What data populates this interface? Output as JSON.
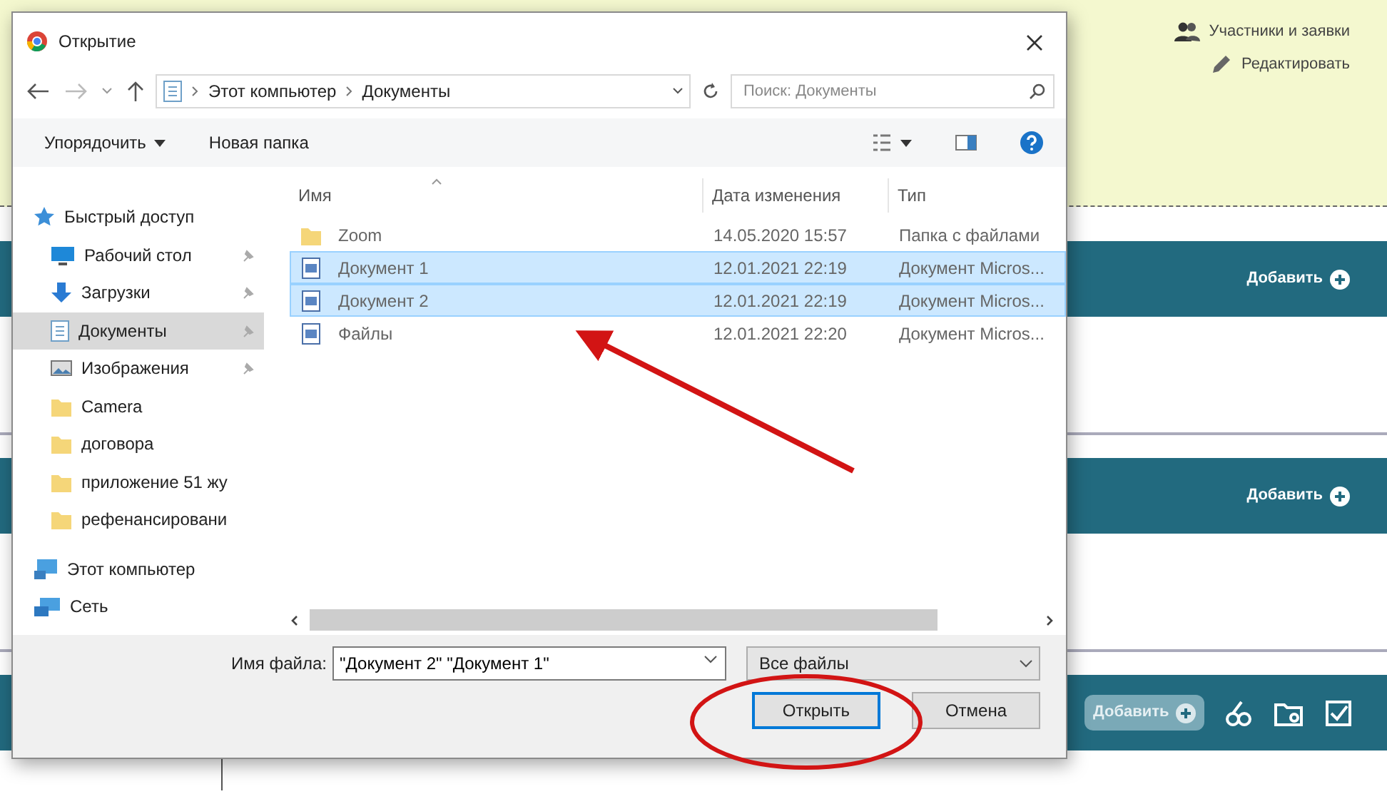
{
  "page": {
    "links": [
      {
        "label": "Участники и заявки",
        "kind": "people"
      },
      {
        "label": "Редактировать",
        "kind": "edit"
      }
    ],
    "sections": [
      {
        "kind": "add",
        "button": "Добавить",
        "disabled": false
      },
      {
        "kind": "add",
        "button": "Добавить",
        "disabled": false
      },
      {
        "kind": "add-with-tools",
        "button": "Добавить",
        "disabled": true
      }
    ]
  },
  "dialog": {
    "title": "Открытие",
    "address": [
      "Этот компьютер",
      "Документы"
    ],
    "search": {
      "placeholder": "Поиск: Документы"
    },
    "toolbar": {
      "organize": "Упорядочить",
      "new_folder": "Новая папка"
    },
    "nav_pane": [
      {
        "label": "Быстрый доступ",
        "kind": "star",
        "selected": false,
        "children": [
          {
            "label": "Рабочий стол",
            "kind": "desktop",
            "pinned": true,
            "selected": false
          },
          {
            "label": "Загрузки",
            "kind": "download",
            "pinned": true,
            "selected": false
          },
          {
            "label": "Документы",
            "kind": "documents",
            "pinned": true,
            "selected": true
          },
          {
            "label": "Изображения",
            "kind": "pictures",
            "pinned": true,
            "selected": false
          },
          {
            "label": "Camera",
            "kind": "folder",
            "pinned": false,
            "selected": false
          },
          {
            "label": "договора",
            "kind": "folder",
            "pinned": false,
            "selected": false
          },
          {
            "label": "приложение 51 жу",
            "kind": "folder",
            "pinned": false,
            "selected": false
          },
          {
            "label": "рефенансировани",
            "kind": "folder",
            "pinned": false,
            "selected": false
          }
        ]
      },
      {
        "label": "Этот компьютер",
        "kind": "computer",
        "selected": false
      },
      {
        "label": "Сеть",
        "kind": "network",
        "selected": false
      }
    ],
    "columns": [
      "Имя",
      "Дата изменения",
      "Тип"
    ],
    "files": [
      {
        "name": "Zoom",
        "date": "14.05.2020 15:57",
        "type": "Папка с файлами",
        "kind": "folder",
        "selected": false
      },
      {
        "name": "Документ 1",
        "date": "12.01.2021 22:19",
        "type": "Документ Micros...",
        "kind": "doc",
        "selected": true
      },
      {
        "name": "Документ 2",
        "date": "12.01.2021 22:19",
        "type": "Документ Micros...",
        "kind": "doc",
        "selected": true
      },
      {
        "name": "Файлы",
        "date": "12.01.2021 22:20",
        "type": "Документ Micros...",
        "kind": "doc",
        "selected": false
      }
    ],
    "file_name": {
      "label": "Имя файла:",
      "value": "\"Документ 2\" \"Документ 1\""
    },
    "filter": "Все файлы",
    "buttons": [
      {
        "label": "Открыть",
        "default": true
      },
      {
        "label": "Отмена",
        "default": false
      }
    ]
  }
}
